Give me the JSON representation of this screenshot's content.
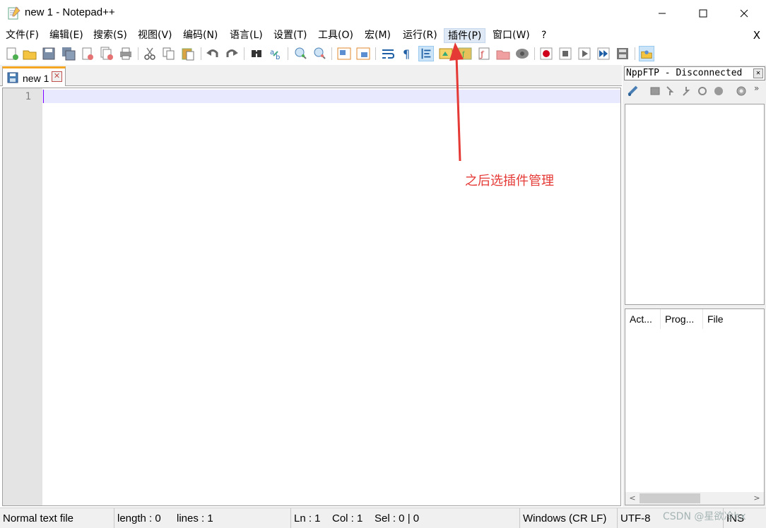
{
  "window": {
    "title": "new 1 - Notepad++",
    "minimize_glyph": "—",
    "maximize_glyph": "☐",
    "close_glyph": "✕"
  },
  "menu": {
    "items": [
      {
        "label": "文件(F)"
      },
      {
        "label": "编辑(E)"
      },
      {
        "label": "搜索(S)"
      },
      {
        "label": "视图(V)"
      },
      {
        "label": "编码(N)"
      },
      {
        "label": "语言(L)"
      },
      {
        "label": "设置(T)"
      },
      {
        "label": "工具(O)"
      },
      {
        "label": "宏(M)"
      },
      {
        "label": "运行(R)"
      },
      {
        "label": "插件(P)"
      },
      {
        "label": "窗口(W)"
      },
      {
        "label": "?"
      }
    ],
    "close_label": "X"
  },
  "tabs": [
    {
      "label": "new 1",
      "close_glyph": "✕"
    }
  ],
  "editor": {
    "line_numbers": [
      "1"
    ]
  },
  "ftp": {
    "title": "NppFTP - Disconnected",
    "close_glyph": "✕",
    "more_glyph": "»",
    "columns": [
      "Act...",
      "Prog...",
      "File"
    ],
    "scroll_left": "<",
    "scroll_right": ">"
  },
  "status": {
    "file_type": "Normal text file",
    "length": "length : 0",
    "lines": "lines : 1",
    "ln": "Ln : 1",
    "col": "Col : 1",
    "sel": "Sel : 0 | 0",
    "eol": "Windows (CR LF)",
    "encoding": "UTF-8",
    "mode": "INS"
  },
  "annotation": {
    "text": "之后选插件管理"
  },
  "watermark": "CSDN @星欲冷hx",
  "colors": {
    "accent_red": "#e53935",
    "tab_orange": "#f5a623",
    "current_line": "#e8e8ff",
    "caret": "#8000ff"
  }
}
